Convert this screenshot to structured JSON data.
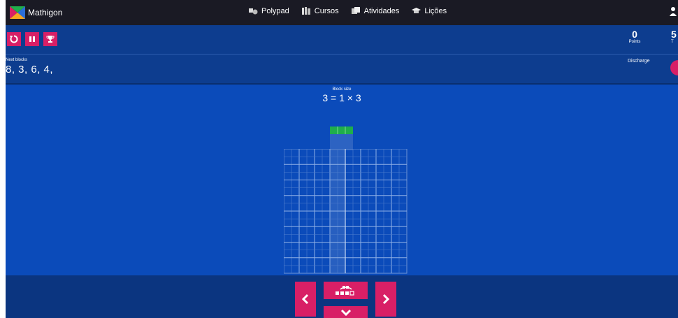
{
  "topbar": {
    "brand": "Mathigon",
    "nav": [
      {
        "label": "Polypad",
        "icon": "polypad-icon"
      },
      {
        "label": "Cursos",
        "icon": "courses-icon"
      },
      {
        "label": "Atividades",
        "icon": "activities-icon"
      },
      {
        "label": "Lições",
        "icon": "lessons-icon"
      }
    ]
  },
  "controls": {
    "restart_icon": "restart-icon",
    "pause_icon": "pause-icon",
    "trophy_icon": "trophy-icon"
  },
  "score": {
    "points_value": "0",
    "points_label": "Points",
    "second_value": "5",
    "second_label": "T"
  },
  "next_blocks": {
    "label": "Next blocks",
    "values": "8, 3, 6, 4,"
  },
  "discharge": {
    "label": "Discharge"
  },
  "block_size": {
    "label": "Block size",
    "equation": "3 = 1 × 3"
  },
  "game": {
    "grid_columns": 8,
    "grid_rows": 8,
    "subdivisions": 2,
    "active_block_width": 3,
    "active_block_height": 1,
    "block_color": "#1fae4b",
    "accent_color": "#d81f66",
    "background_color": "#0b4bba"
  },
  "bottom_controls": {
    "left_icon": "chevron-left-icon",
    "rotate_icon": "rotate-block-icon",
    "down_icon": "chevron-down-icon",
    "right_icon": "chevron-right-icon"
  }
}
